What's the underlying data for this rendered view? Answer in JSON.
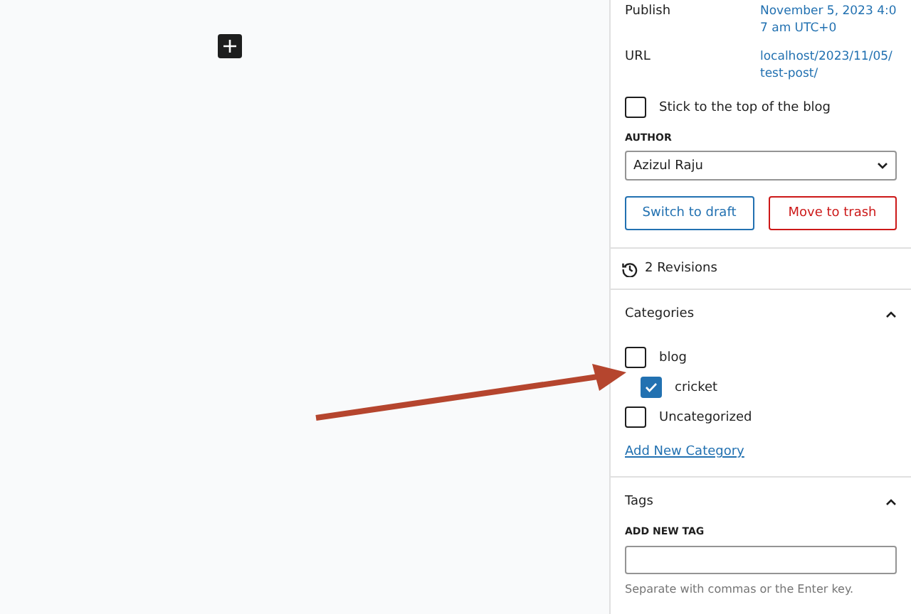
{
  "publish": {
    "label": "Publish",
    "value": "November 5, 2023 4:07 am UTC+0"
  },
  "url": {
    "label": "URL",
    "value": "localhost/2023/11/05/test-post/"
  },
  "sticky": {
    "label": "Stick to the top of the blog",
    "checked": false
  },
  "author": {
    "label": "AUTHOR",
    "value": "Azizul Raju"
  },
  "buttons": [
    {
      "label": "Switch to draft",
      "kind": "secondary"
    },
    {
      "label": "Move to trash",
      "kind": "danger"
    }
  ],
  "revisions": "2 Revisions",
  "categories": {
    "title": "Categories",
    "expanded": true,
    "items": [
      {
        "label": "blog",
        "checked": false,
        "children": [
          {
            "label": "cricket",
            "checked": true
          }
        ]
      },
      {
        "label": "Uncategorized",
        "checked": false
      }
    ],
    "add_link": "Add New Category"
  },
  "tags": {
    "title": "Tags",
    "expanded": true,
    "label": "ADD NEW TAG",
    "help": "Separate with commas or the Enter key."
  }
}
